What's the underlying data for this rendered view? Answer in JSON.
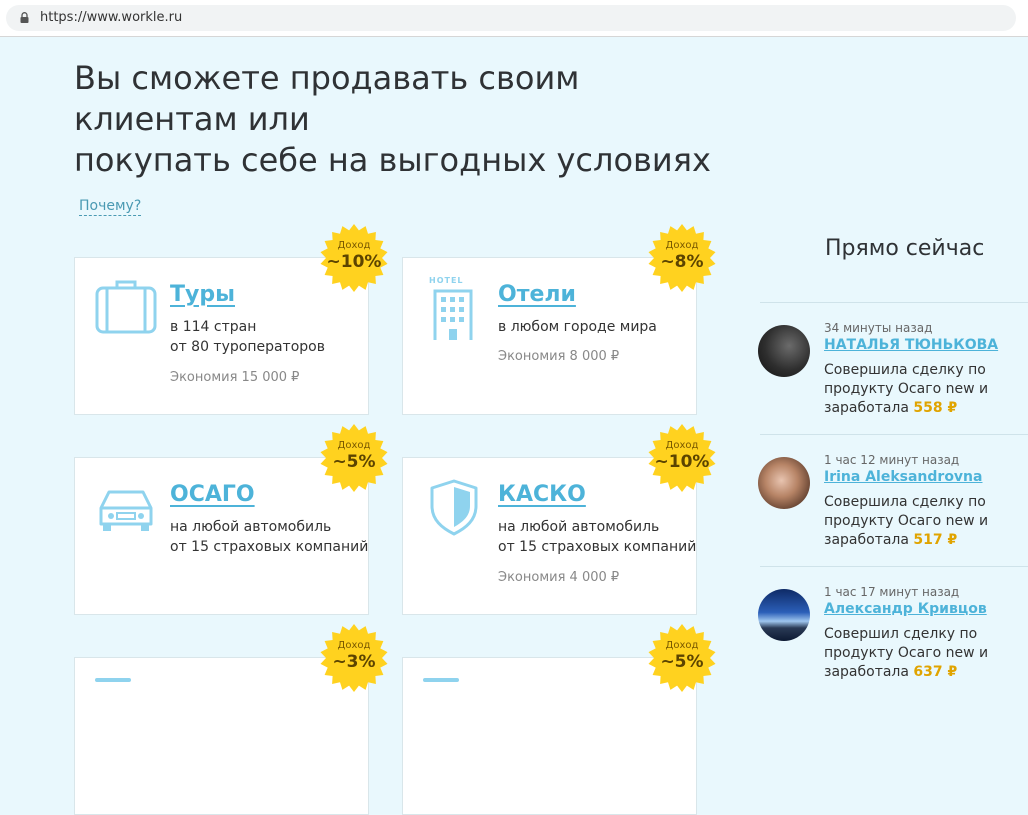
{
  "browser": {
    "url": "https://www.workle.ru"
  },
  "heading": {
    "line1": "Вы сможете продавать своим",
    "line2": "клиентам или",
    "line3": "покупать себе на выгодных условиях"
  },
  "why_link": "Почему?",
  "badge_label": "Доход",
  "cards": [
    {
      "title": "Туры",
      "line1": "в 114 стран",
      "line2": "от 80 туроператоров",
      "savings": "Экономия 15 000 ₽",
      "income": "~10%",
      "icon": "suitcase-icon"
    },
    {
      "title": "Отели",
      "line1": "в любом городе мира",
      "savings": "Экономия 8 000 ₽",
      "income": "~8%",
      "icon": "hotel-icon",
      "icon_text": "HOTEL"
    },
    {
      "title": "ОСАГО",
      "line1": "на любой автомобиль",
      "line2": "от 15 страховых компаний",
      "income": "~5%",
      "icon": "car-icon"
    },
    {
      "title": "КАСКО",
      "line1": "на любой автомобиль",
      "line2": "от 15 страховых компаний",
      "savings": "Экономия 4 000 ₽",
      "income": "~10%",
      "icon": "shield-icon"
    },
    {
      "income": "~3%"
    },
    {
      "income": "~5%"
    }
  ],
  "feed": {
    "title": "Прямо сейчас",
    "items": [
      {
        "time": "34 минуты назад",
        "name": "НАТАЛЬЯ ТЮНЬКОВА",
        "text1": "Совершила сделку по",
        "text2": "продукту Осаго new и",
        "text3": "заработала",
        "amount": "558 ₽"
      },
      {
        "time": "1 час 12 минут назад",
        "name": "Irina Aleksandrovna",
        "text1": "Совершила сделку по",
        "text2": "продукту Осаго new и",
        "text3": "заработала",
        "amount": "517 ₽"
      },
      {
        "time": "1 час 17 минут назад",
        "name": "Александр Кривцов",
        "text1": "Совершил сделку по",
        "text2": "продукту Осаго new и",
        "text3": "заработала",
        "amount": "637 ₽"
      }
    ]
  },
  "colors": {
    "accent": "#4db3d9",
    "badge": "#ffd21f",
    "background": "#e9f8fd",
    "amount": "#e0a400"
  }
}
